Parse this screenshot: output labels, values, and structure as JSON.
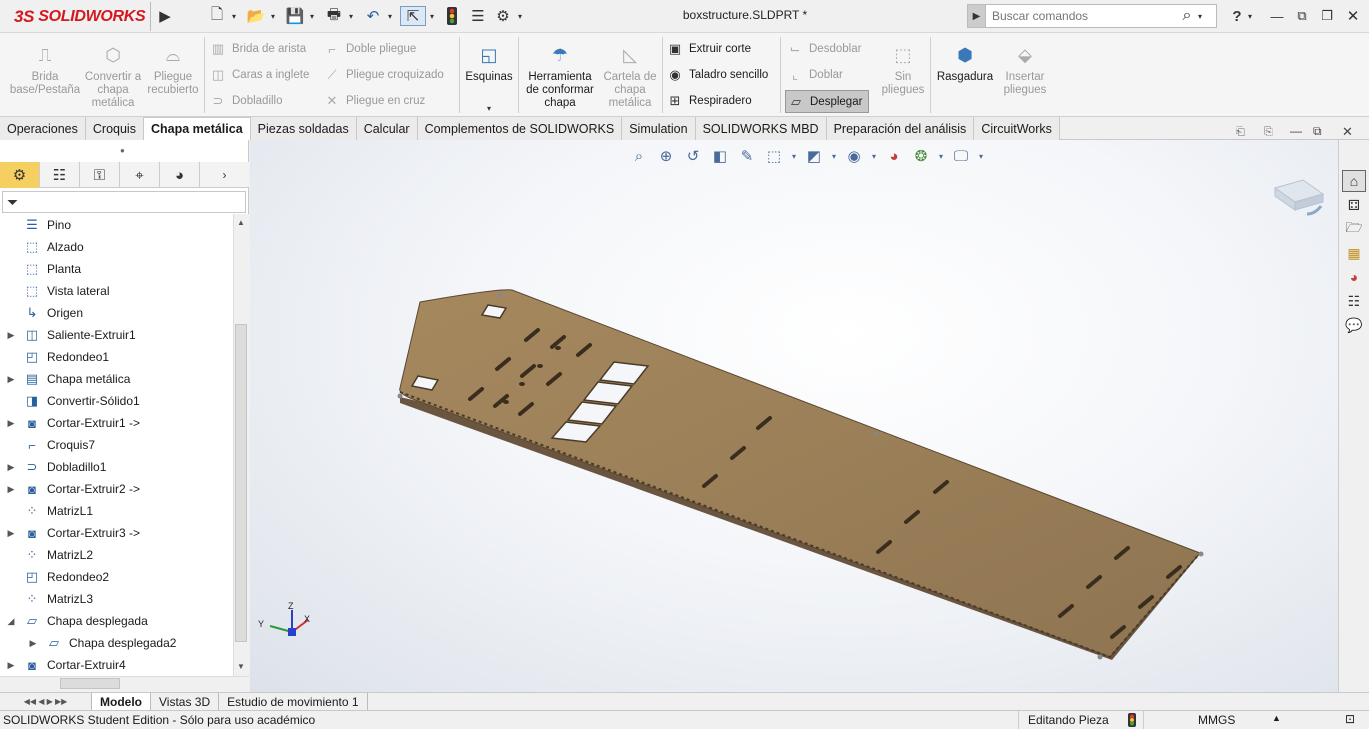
{
  "app": {
    "logo_prefix": "3S",
    "logo_text": "SOLIDWORKS",
    "doc_title": "boxstructure.SLDPRT *"
  },
  "search": {
    "placeholder": "Buscar comandos"
  },
  "help": {
    "label": "?"
  },
  "ribbon": {
    "brida_base": "Brida base/Pestaña",
    "convertir": "Convertir a chapa metálica",
    "pliegue_recubierto": "Pliegue recubierto",
    "brida_arista": "Brida de arista",
    "caras_inglete": "Caras a inglete",
    "dobladillo": "Dobladillo",
    "doble_pliegue": "Doble pliegue",
    "pliegue_croquizado": "Pliegue croquizado",
    "pliegue_cruz": "Pliegue en cruz",
    "esquinas": "Esquinas",
    "herramienta": "Herramienta de conformar chapa",
    "cartela": "Cartela de chapa metálica",
    "extruir_corte": "Extruir corte",
    "taladro": "Taladro sencillo",
    "respiradero": "Respiradero",
    "desdoblar": "Desdoblar",
    "doblar": "Doblar",
    "desplegar": "Desplegar",
    "sin_pliegues": "Sin pliegues",
    "rasgadura": "Rasgadura",
    "insertar_pliegues": "Insertar pliegues"
  },
  "command_tabs": [
    "Operaciones",
    "Croquis",
    "Chapa metálica",
    "Piezas soldadas",
    "Calcular",
    "Complementos de SOLIDWORKS",
    "Simulation",
    "SOLIDWORKS MBD",
    "Preparación del análisis",
    "CircuitWorks"
  ],
  "tree": [
    {
      "label": "Pino",
      "icon": "sensor-icon",
      "expandable": false
    },
    {
      "label": "Alzado",
      "icon": "plane-icon",
      "expandable": false
    },
    {
      "label": "Planta",
      "icon": "plane-icon",
      "expandable": false
    },
    {
      "label": "Vista lateral",
      "icon": "plane-icon",
      "expandable": false
    },
    {
      "label": "Origen",
      "icon": "origin-icon",
      "expandable": false
    },
    {
      "label": "Saliente-Extruir1",
      "icon": "extrude-icon",
      "expandable": true
    },
    {
      "label": "Redondeo1",
      "icon": "fillet-icon",
      "expandable": false
    },
    {
      "label": "Chapa metálica",
      "icon": "sheet-metal-icon",
      "expandable": true
    },
    {
      "label": "Convertir-Sólido1",
      "icon": "convert-icon",
      "expandable": false
    },
    {
      "label": "Cortar-Extruir1 ->",
      "icon": "cut-extrude-icon",
      "expandable": true
    },
    {
      "label": "Croquis7",
      "icon": "sketch-icon",
      "expandable": false
    },
    {
      "label": "Dobladillo1",
      "icon": "hem-icon",
      "expandable": true
    },
    {
      "label": "Cortar-Extruir2 ->",
      "icon": "cut-extrude-icon",
      "expandable": true
    },
    {
      "label": "MatrizL1",
      "icon": "pattern-icon",
      "expandable": false
    },
    {
      "label": "Cortar-Extruir3 ->",
      "icon": "cut-extrude-icon",
      "expandable": true
    },
    {
      "label": "MatrizL2",
      "icon": "pattern-icon",
      "expandable": false
    },
    {
      "label": "Redondeo2",
      "icon": "fillet-icon",
      "expandable": false
    },
    {
      "label": "MatrizL3",
      "icon": "pattern-icon",
      "expandable": false
    },
    {
      "label": "Chapa desplegada",
      "icon": "flat-pattern-icon",
      "expandable": true,
      "expanded": true
    },
    {
      "label": "Chapa desplegada2",
      "icon": "flat-pattern-icon",
      "expandable": true,
      "child": true
    },
    {
      "label": "Cortar-Extruir4",
      "icon": "cut-extrude-icon",
      "expandable": true
    }
  ],
  "bottom_tabs": [
    "Modelo",
    "Vistas 3D",
    "Estudio de movimiento 1"
  ],
  "status": {
    "edition": "SOLIDWORKS Student Edition - Sólo para uso académico",
    "mode": "Editando Pieza",
    "units": "MMGS"
  },
  "triad": {
    "x": "X",
    "y": "Y",
    "z": "Z"
  }
}
